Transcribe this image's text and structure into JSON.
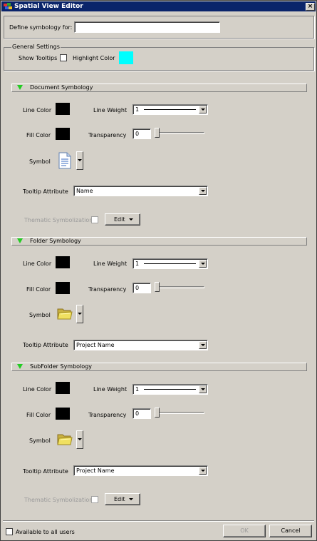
{
  "window": {
    "title": "Spatial View Editor",
    "close_glyph": "×"
  },
  "define": {
    "label": "Define symbology for:",
    "value": ""
  },
  "general": {
    "group_label": "General Settings",
    "show_tooltips_label": "Show Tooltips",
    "show_tooltips_checked": false,
    "highlight_label": "Highlight Color",
    "highlight_color": "#00ffff"
  },
  "sections": [
    {
      "title": "Document Symbology",
      "line_color_label": "Line Color",
      "line_weight_label": "Line Weight",
      "line_weight_value": "1",
      "fill_color_label": "Fill Color",
      "transparency_label": "Transparency",
      "transparency_value": "0",
      "symbol_label": "Symbol",
      "symbol_icon": "document-icon",
      "tooltip_label": "Tooltip Attribute",
      "tooltip_value": "Name",
      "thematic_label": "Thematic Symbolization",
      "edit_label": "Edit"
    },
    {
      "title": "Folder Symbology",
      "line_color_label": "Line Color",
      "line_weight_label": "Line Weight",
      "line_weight_value": "1",
      "fill_color_label": "Fill Color",
      "transparency_label": "Transparency",
      "transparency_value": "0",
      "symbol_label": "Symbol",
      "symbol_icon": "folder-icon",
      "tooltip_label": "Tooltip Attribute",
      "tooltip_value": "Project Name"
    },
    {
      "title": "SubFolder Symbology",
      "line_color_label": "Line Color",
      "line_weight_label": "Line Weight",
      "line_weight_value": "1",
      "fill_color_label": "Fill Color",
      "transparency_label": "Transparency",
      "transparency_value": "0",
      "symbol_label": "Symbol",
      "symbol_icon": "folder-icon",
      "tooltip_label": "Tooltip Attribute",
      "tooltip_value": "Project Name",
      "thematic_label": "Thematic Symbolization",
      "edit_label": "Edit"
    }
  ],
  "footer": {
    "available_label": "Available to all users",
    "ok_label": "OK",
    "cancel_label": "Cancel"
  },
  "colors": {
    "title_bar": "#0a246a",
    "swatch": "#000000",
    "section_triangle": "#22cc22"
  }
}
